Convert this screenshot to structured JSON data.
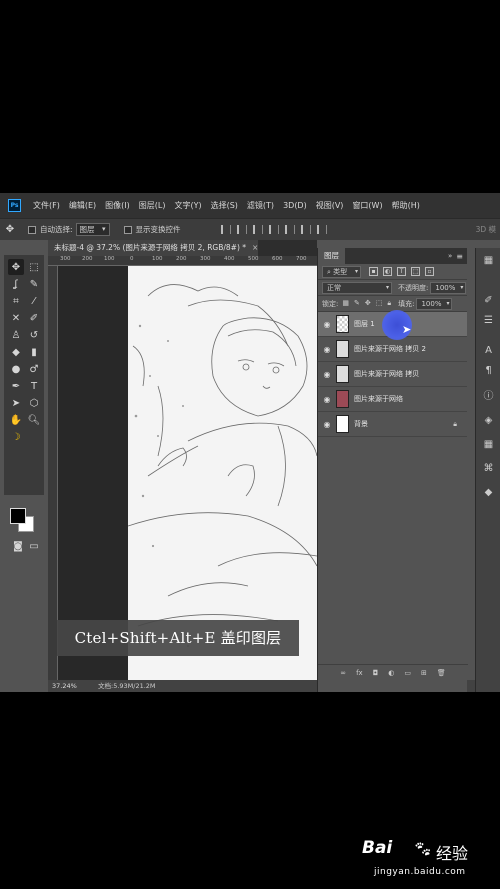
{
  "menubar": {
    "app_icon": "Ps",
    "items": [
      "文件(F)",
      "编辑(E)",
      "图像(I)",
      "图层(L)",
      "文字(Y)",
      "选择(S)",
      "滤镜(T)",
      "3D(D)",
      "视图(V)",
      "窗口(W)",
      "帮助(H)"
    ]
  },
  "options": {
    "auto_select_label": "自动选择:",
    "auto_select_value": "图层",
    "show_transform_label": "显示变换控件",
    "mode_3d_label": "3D 模"
  },
  "document": {
    "tab_title": "未标题-4 @ 37.2% (图片来源于网络 拷贝 2, RGB/8#) *",
    "close_glyph": "×",
    "ruler_ticks": [
      "300",
      "200",
      "100",
      "0",
      "100",
      "200",
      "300",
      "400",
      "500",
      "600",
      "700"
    ]
  },
  "statusbar": {
    "zoom": "37.24%",
    "doc_info": "文档:5.93M/21.2M"
  },
  "caption": {
    "text": "Ctel+Shift+Alt+E 盖印图层"
  },
  "layers_panel": {
    "tab_label": "图层",
    "filter_kind": "类型",
    "blend_mode": "正常",
    "opacity_label": "不透明度:",
    "opacity_value": "100%",
    "lock_label": "锁定:",
    "fill_label": "填充:",
    "fill_value": "100%",
    "layers": [
      {
        "name": "图层 1",
        "thumb": "transparent",
        "selected": true
      },
      {
        "name": "图片来源于网络 拷贝 2",
        "thumb": "sketch",
        "selected": false
      },
      {
        "name": "图片来源于网络 拷贝",
        "thumb": "sketch",
        "selected": false
      },
      {
        "name": "图片来源于网络",
        "thumb": "color",
        "selected": false
      },
      {
        "name": "背景",
        "thumb": "white",
        "selected": false,
        "locked": true
      }
    ],
    "bottom_icons": [
      "link-icon",
      "fx-icon",
      "mask-icon",
      "adjustment-icon",
      "group-icon",
      "new-layer-icon",
      "trash-icon"
    ]
  },
  "watermark": {
    "brand": "Bai",
    "brand_cn": "经验",
    "url": "jingyan.baidu.com"
  }
}
